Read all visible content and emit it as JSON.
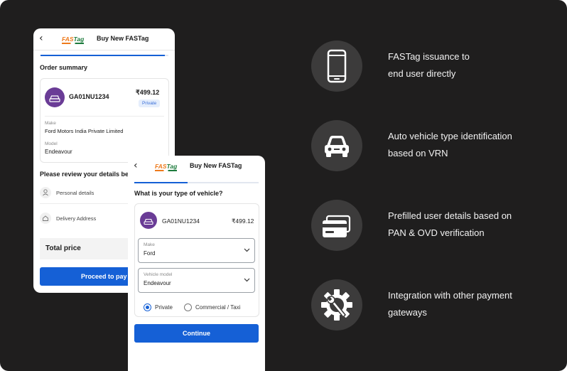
{
  "order_screen": {
    "header": {
      "back_glyph": "‹",
      "logo_part1": "FAS",
      "logo_part2": "Tag",
      "title": "Buy New FASTag"
    },
    "section_title": "Order summary",
    "vehicle": {
      "vrn": "GA01NU1234",
      "price": "₹499.12",
      "badge": "Private"
    },
    "make_label": "Make",
    "make_value": "Ford Motors India Private Limited",
    "model_label": "Model",
    "model_value": "Endeavour",
    "review_title": "Please review your details be",
    "review_items": [
      "Personal details",
      "Delivery Address"
    ],
    "total_label": "Total price",
    "button": "Proceed to pay"
  },
  "vehicle_screen": {
    "header": {
      "back_glyph": "‹",
      "logo_part1": "FAS",
      "logo_part2": "Tag",
      "title": "Buy New FASTag"
    },
    "question": "What is your type of vehicle?",
    "vehicle": {
      "vrn": "GA01NU1234",
      "price": "₹499.12"
    },
    "make_field": {
      "label": "Make",
      "value": "Ford"
    },
    "model_field": {
      "label": "Vehicle model",
      "value": "Endeavour"
    },
    "options": {
      "selected": "Private",
      "other": "Commercial / Taxi"
    },
    "button": "Continue"
  },
  "features": [
    {
      "icon": "smartphone-icon",
      "line1": "FASTag issuance to",
      "line2": "end user directly"
    },
    {
      "icon": "car-icon",
      "line1": "Auto vehicle type identification",
      "line2": "based on VRN"
    },
    {
      "icon": "credit-card-icon",
      "line1": "Prefilled user details based on",
      "line2": "PAN & OVD  verification"
    },
    {
      "icon": "gear-wrench-icon",
      "line1": "Integration with other payment",
      "line2": "gateways"
    }
  ],
  "colors": {
    "background": "#1f1e1e",
    "primary_button": "#1560d6",
    "avatar": "#6a3c96",
    "icon_circle": "#3c3b3b",
    "logo_orange": "#ee7a1c",
    "logo_green": "#1d7b3d"
  }
}
